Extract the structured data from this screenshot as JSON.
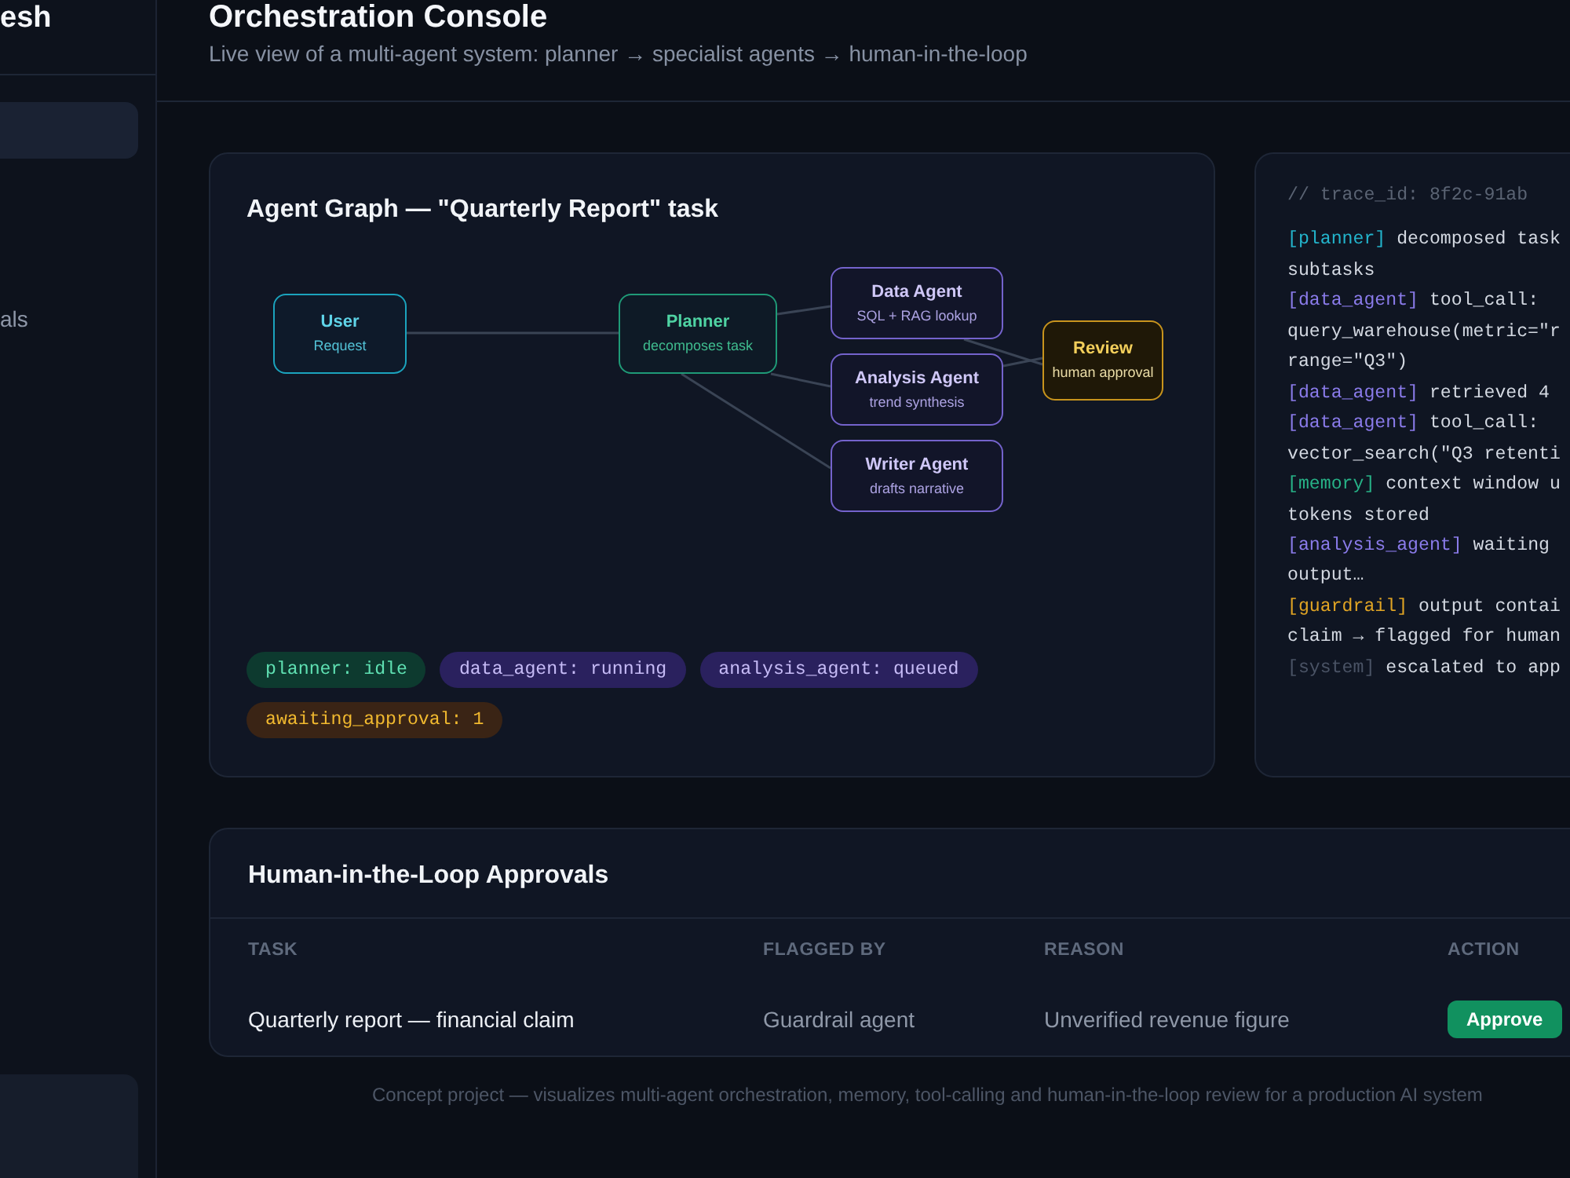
{
  "sidebar": {
    "brand": "esh",
    "items": [
      {
        "selected": true
      },
      {
        "label": "als",
        "selected": false
      }
    ]
  },
  "header": {
    "title": "Orchestration Console",
    "subtitle": "Live view of a multi-agent system: planner → specialist agents → human-in-the-loop"
  },
  "graph": {
    "title": "Agent Graph — \"Quarterly Report\" task",
    "nodes": [
      {
        "kind": "user",
        "label": "User",
        "sublabel": "Request"
      },
      {
        "kind": "planner",
        "label": "Planner",
        "sublabel": "decomposes task"
      },
      {
        "kind": "agent",
        "label": "Data Agent",
        "sublabel": "SQL + RAG lookup"
      },
      {
        "kind": "agent",
        "label": "Analysis Agent",
        "sublabel": "trend synthesis"
      },
      {
        "kind": "agent",
        "label": "Writer Agent",
        "sublabel": "drafts narrative"
      },
      {
        "kind": "review",
        "label": "Review",
        "sublabel": "human approval"
      }
    ],
    "status_chips": [
      {
        "kind": "idle",
        "label": "planner: idle"
      },
      {
        "kind": "running",
        "label": "data_agent: running"
      },
      {
        "kind": "queued",
        "label": "analysis_agent: queued"
      },
      {
        "kind": "awaiting",
        "label": "awaiting_approval: 1"
      }
    ]
  },
  "trace": {
    "comment": "// trace_id: 8f2c-91ab",
    "entries": [
      {
        "kind": "planner",
        "tag": "[planner]",
        "lines": [
          "decomposed task",
          "subtasks"
        ]
      },
      {
        "kind": "agent",
        "tag": "[data_agent]",
        "lines": [
          "tool_call:",
          "query_warehouse(metric=\"r",
          "range=\"Q3\")"
        ]
      },
      {
        "kind": "agent",
        "tag": "[data_agent]",
        "lines": [
          "retrieved 4"
        ]
      },
      {
        "kind": "agent",
        "tag": "[data_agent]",
        "lines": [
          "tool_call:",
          "vector_search(\"Q3 retenti"
        ]
      },
      {
        "kind": "memory",
        "tag": "[memory]",
        "lines": [
          "context window u",
          "tokens stored"
        ]
      },
      {
        "kind": "agent",
        "tag": "[analysis_agent]",
        "lines": [
          "waiting",
          "output…"
        ]
      },
      {
        "kind": "guardrail",
        "tag": "[guardrail]",
        "lines": [
          "output contai",
          "claim → flagged for human"
        ]
      },
      {
        "kind": "system",
        "tag": "[system]",
        "lines": [
          "escalated to app"
        ]
      }
    ]
  },
  "approvals": {
    "title": "Human-in-the-Loop Approvals",
    "columns": [
      "TASK",
      "FLAGGED BY",
      "REASON",
      "ACTION"
    ],
    "rows": [
      {
        "task": "Quarterly report — financial claim",
        "flagged_by": "Guardrail agent",
        "reason": "Unverified revenue figure",
        "action": "Approve"
      }
    ]
  },
  "footer_note": "Concept project — visualizes multi-agent orchestration, memory, tool-calling and human-in-the-loop review for a production AI system"
}
